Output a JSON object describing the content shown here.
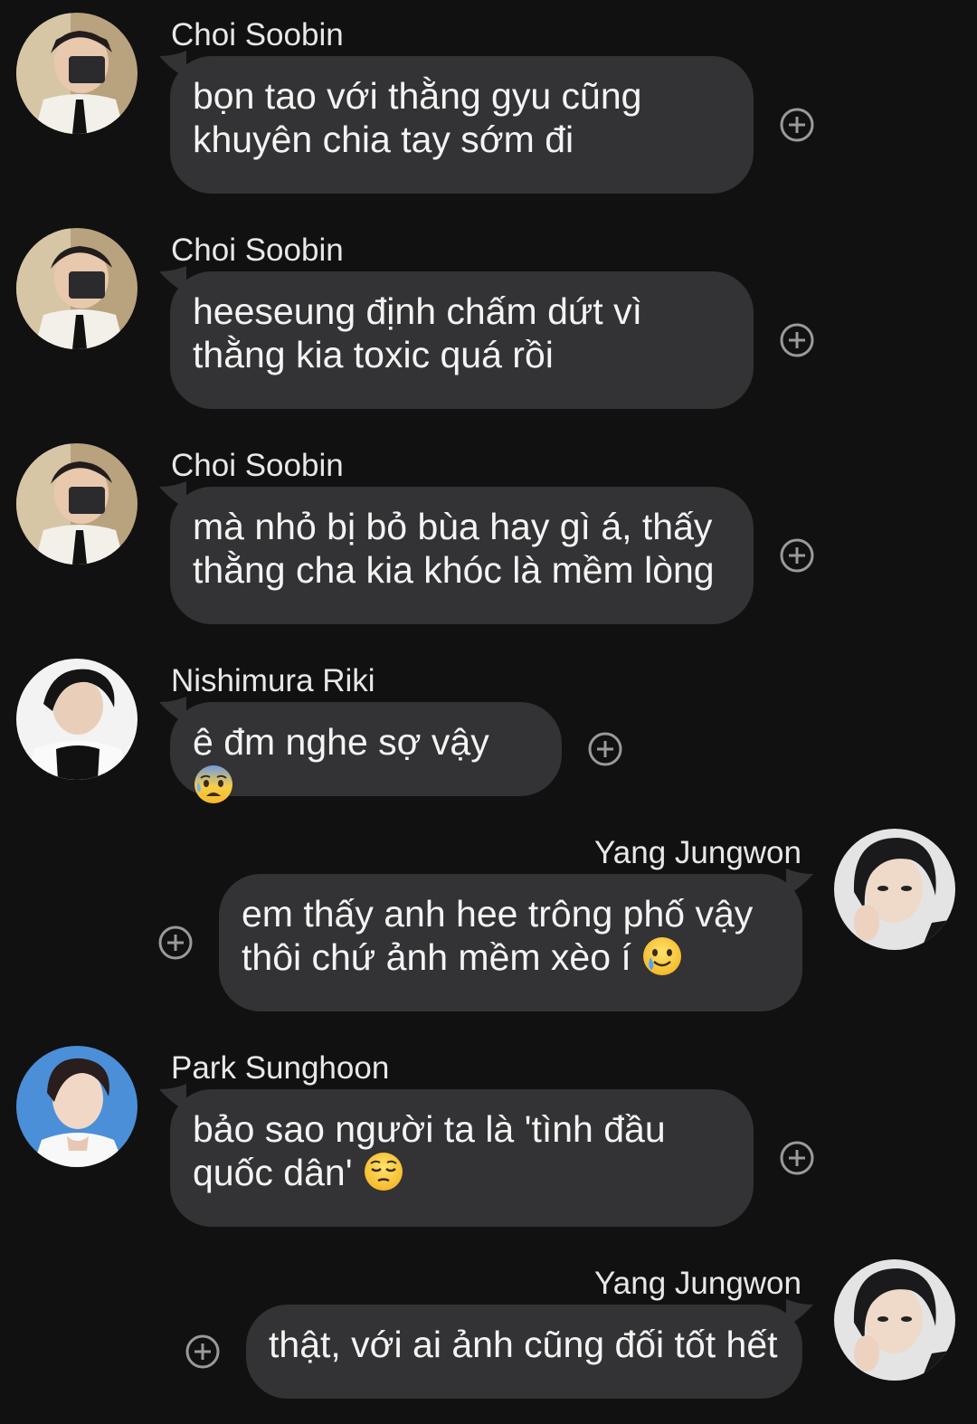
{
  "messages": [
    {
      "sender": "Choi Soobin",
      "text": "bọn tao với thằng gyu cũng\nkhuyên chia tay sớm đi",
      "direction": "incoming",
      "avatar": "avatar-choi-soobin"
    },
    {
      "sender": "Choi Soobin",
      "text": "heeseung định chấm dứt vì\nthằng kia toxic quá rồi",
      "direction": "incoming",
      "avatar": "avatar-choi-soobin"
    },
    {
      "sender": "Choi Soobin",
      "text": "mà nhỏ bị bỏ bùa hay gì á, thấy\nthằng cha kia khóc là mềm lòng",
      "direction": "incoming",
      "avatar": "avatar-choi-soobin"
    },
    {
      "sender": "Nishimura Riki",
      "text": "ê đm nghe sợ vậy ",
      "emoji": "anxious-face-with-sweat",
      "direction": "incoming",
      "avatar": "avatar-nishimura-riki"
    },
    {
      "sender": "Yang Jungwon",
      "text": "em thấy anh hee trông phố vậy\nthôi chứ ảnh mềm xèo í ",
      "emoji": "smiling-face-with-tear",
      "direction": "outgoing",
      "avatar": "avatar-yang-jungwon"
    },
    {
      "sender": "Park Sunghoon",
      "text": "bảo sao người ta là 'tình đầu\nquốc dân' ",
      "emoji": "pensive-face",
      "direction": "incoming",
      "avatar": "avatar-park-sunghoon"
    },
    {
      "sender": "Yang Jungwon",
      "text": "thật, với ai ảnh cũng đối tốt hết",
      "direction": "outgoing",
      "avatar": "avatar-yang-jungwon"
    }
  ],
  "icons": {
    "reaction": "add-reaction-icon"
  },
  "colors": {
    "background": "#111112",
    "bubble": "#333335",
    "text": "#f4f4f4",
    "icon": "#9a9a9a"
  }
}
